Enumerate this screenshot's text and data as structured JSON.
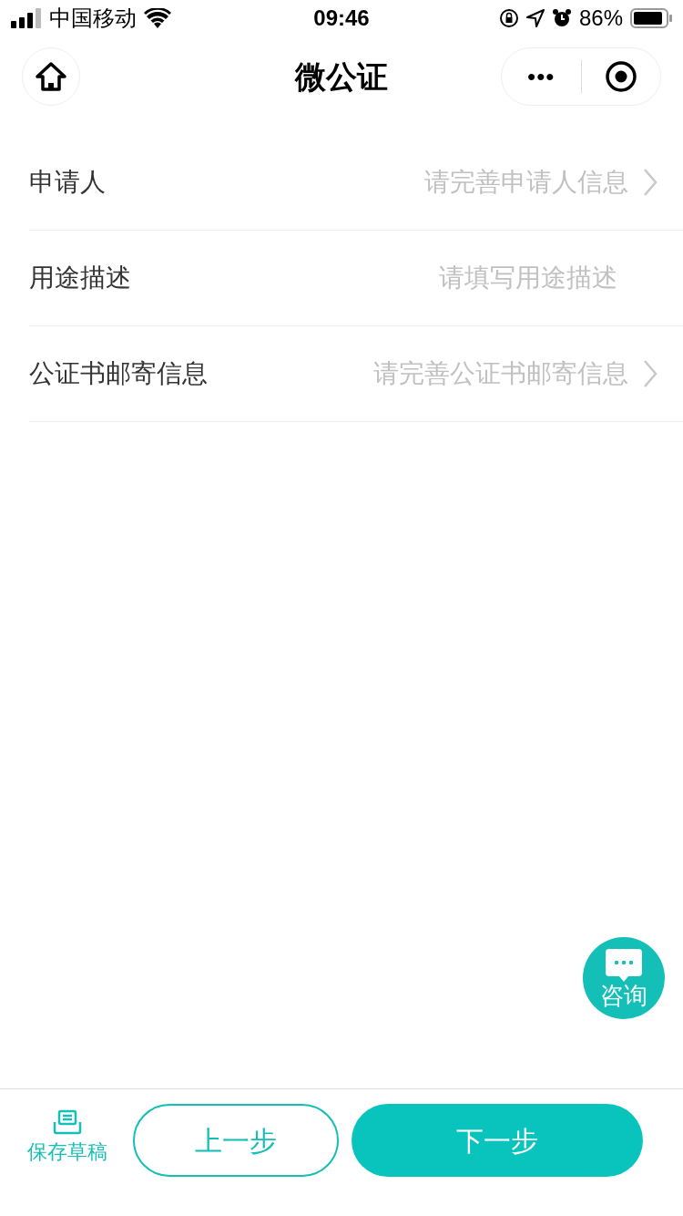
{
  "status_bar": {
    "carrier": "中国移动",
    "time": "09:46",
    "battery": "86%"
  },
  "nav": {
    "title": "微公证",
    "more": "•••"
  },
  "rows": [
    {
      "kind": "link",
      "label": "申请人",
      "placeholder": "请完善申请人信息"
    },
    {
      "kind": "input",
      "label": "用途描述",
      "placeholder": "请填写用途描述"
    },
    {
      "kind": "link",
      "label": "公证书邮寄信息",
      "placeholder": "请完善公证书邮寄信息"
    }
  ],
  "consult": {
    "label": "咨询"
  },
  "footer": {
    "save": "保存草稿",
    "prev": "上一步",
    "next": "下一步"
  }
}
